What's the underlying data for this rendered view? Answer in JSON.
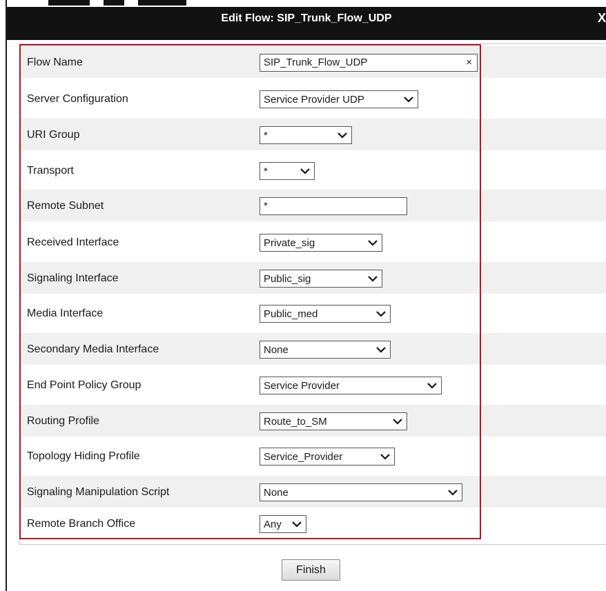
{
  "dialog": {
    "title": "Edit Flow: SIP_Trunk_Flow_UDP",
    "close_label": "X"
  },
  "form": {
    "rows": [
      {
        "label": "Flow Name",
        "kind": "text",
        "value": "SIP_Trunk_Flow_UDP",
        "clear": "×"
      },
      {
        "label": "Server Configuration",
        "kind": "select",
        "value": "Service Provider UDP"
      },
      {
        "label": "URI Group",
        "kind": "select",
        "value": "*"
      },
      {
        "label": "Transport",
        "kind": "select",
        "value": "*"
      },
      {
        "label": "Remote Subnet",
        "kind": "text",
        "value": "*"
      },
      {
        "label": "Received Interface",
        "kind": "select",
        "value": "Private_sig"
      },
      {
        "label": "Signaling Interface",
        "kind": "select",
        "value": "Public_sig"
      },
      {
        "label": "Media Interface",
        "kind": "select",
        "value": "Public_med"
      },
      {
        "label": "Secondary Media Interface",
        "kind": "select",
        "value": "None"
      },
      {
        "label": "End Point Policy Group",
        "kind": "select",
        "value": "Service Provider"
      },
      {
        "label": "Routing Profile",
        "kind": "select",
        "value": "Route_to_SM"
      },
      {
        "label": "Topology Hiding Profile",
        "kind": "select",
        "value": "Service_Provider"
      },
      {
        "label": "Signaling Manipulation Script",
        "kind": "select",
        "value": "None"
      },
      {
        "label": "Remote Branch Office",
        "kind": "select",
        "value": "Any"
      }
    ]
  },
  "footer": {
    "finish_label": "Finish"
  },
  "colors": {
    "title_bar": "#121212",
    "highlight_border": "#b8131d",
    "alt_row": "#f0f0f0"
  }
}
